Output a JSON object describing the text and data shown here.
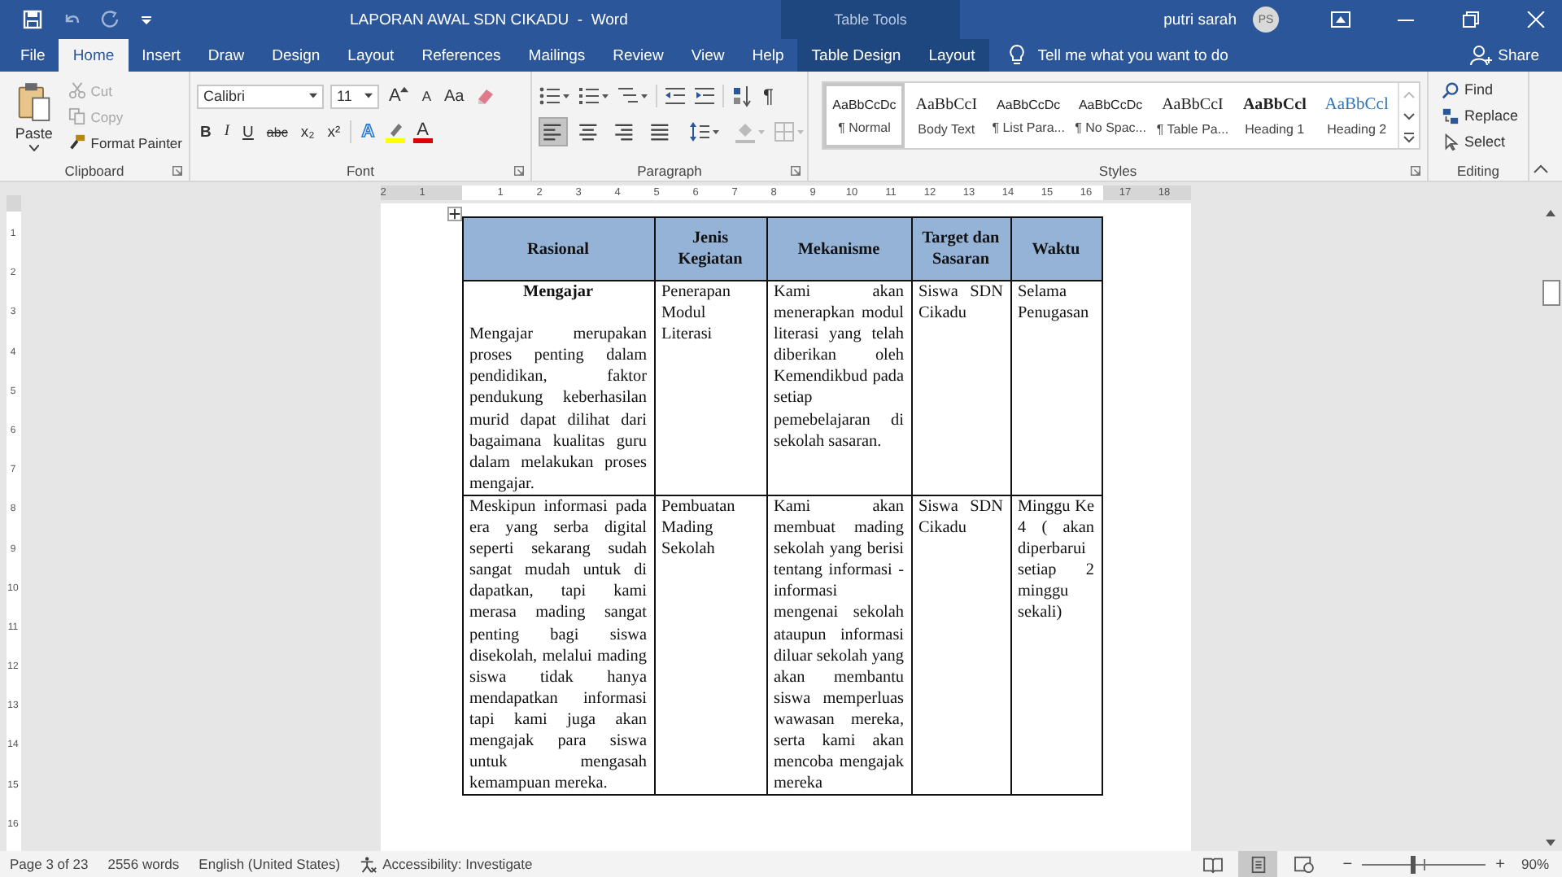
{
  "title_bar": {
    "title": "LAPORAN AWAL SDN CIKADU  -  Word",
    "context_title": "Table Tools",
    "user_name": "putri sarah",
    "avatar_initials": "PS"
  },
  "tabs": [
    {
      "label": "File",
      "selected": false,
      "contextual": false
    },
    {
      "label": "Home",
      "selected": true,
      "contextual": false
    },
    {
      "label": "Insert",
      "selected": false,
      "contextual": false
    },
    {
      "label": "Draw",
      "selected": false,
      "contextual": false
    },
    {
      "label": "Design",
      "selected": false,
      "contextual": false
    },
    {
      "label": "Layout",
      "selected": false,
      "contextual": false
    },
    {
      "label": "References",
      "selected": false,
      "contextual": false
    },
    {
      "label": "Mailings",
      "selected": false,
      "contextual": false
    },
    {
      "label": "Review",
      "selected": false,
      "contextual": false
    },
    {
      "label": "View",
      "selected": false,
      "contextual": false
    },
    {
      "label": "Help",
      "selected": false,
      "contextual": false
    },
    {
      "label": "Table Design",
      "selected": false,
      "contextual": true
    },
    {
      "label": "Layout",
      "selected": false,
      "contextual": true
    }
  ],
  "tell_me": {
    "placeholder": "Tell me what you want to do"
  },
  "share_label": "Share",
  "clipboard": {
    "label": "Clipboard",
    "paste": "Paste",
    "items": [
      {
        "label": "Cut",
        "disabled": true
      },
      {
        "label": "Copy",
        "disabled": true
      },
      {
        "label": "Format Painter",
        "disabled": false
      }
    ]
  },
  "font": {
    "label": "Font",
    "family": "Calibri",
    "size": "11",
    "grow": "A",
    "shrink": "A",
    "change_case": "Aa",
    "format_buttons": [
      "B",
      "I",
      "U",
      "abc",
      "x₂",
      "x²"
    ],
    "effects": "A",
    "font_color": "A"
  },
  "paragraph": {
    "label": "Paragraph",
    "pilcrow": "¶",
    "alignments": [
      {
        "kind": "left",
        "selected": true
      },
      {
        "kind": "center",
        "selected": false
      },
      {
        "kind": "right",
        "selected": false
      },
      {
        "kind": "justify",
        "selected": false
      }
    ]
  },
  "styles": {
    "label": "Styles",
    "items": [
      {
        "preview": "AaBbCcDc",
        "name": "¶ Normal",
        "selected": true
      },
      {
        "preview": "AaBbCcI",
        "name": "Body Text",
        "selected": false
      },
      {
        "preview": "AaBbCcDc",
        "name": "¶ List Para...",
        "selected": false
      },
      {
        "preview": "AaBbCcDc",
        "name": "¶ No Spac...",
        "selected": false
      },
      {
        "preview": "AaBbCcI",
        "name": "¶ Table Pa...",
        "selected": false
      },
      {
        "preview": "AaBbCcl",
        "name": "Heading 1",
        "selected": false
      },
      {
        "preview": "AaBbCcl",
        "name": "Heading 2",
        "selected": false
      }
    ]
  },
  "editing": {
    "label": "Editing",
    "items": [
      "Find",
      "Replace",
      "Select"
    ]
  },
  "ruler": {
    "left_numbers": [
      "2",
      "1"
    ],
    "numbers": [
      "1",
      "2",
      "3",
      "4",
      "5",
      "6",
      "7",
      "8",
      "9",
      "10",
      "11",
      "12",
      "13",
      "14",
      "15",
      "16",
      "17",
      "18"
    ]
  },
  "vertical_ruler": {
    "numbers": [
      "1",
      "2",
      "3",
      "4",
      "5",
      "6",
      "7",
      "8",
      "9",
      "10",
      "11",
      "12",
      "13",
      "14",
      "15",
      "16"
    ]
  },
  "table": {
    "columns": [
      "Rasional",
      "Jenis Kegiatan",
      "Mekanisme",
      "Target dan Sasaran",
      "Waktu"
    ],
    "rows": [
      {
        "cells": [
          {
            "heading": "Mengajar",
            "text": "Mengajar merupakan proses penting dalam pendidikan, faktor pendukung keberhasilan murid dapat dilihat dari bagaimana kualitas guru dalam melakukan proses mengajar."
          },
          {
            "text": "Penerapan Modul Literasi"
          },
          {
            "text": "Kami akan menerapkan modul literasi yang telah diberikan oleh Kemendikbud pada setiap pemebelajaran di sekolah sasaran."
          },
          {
            "text": "Siswa SDN Cikadu"
          },
          {
            "text": "Selama Penugasan"
          }
        ]
      },
      {
        "cells": [
          {
            "text": "Meskipun informasi pada era yang serba digital seperti sekarang sudah sangat mudah untuk di dapatkan, tapi kami merasa mading sangat penting bagi siswa disekolah, melalui mading siswa tidak hanya mendapatkan informasi tapi kami juga akan mengajak para siswa untuk mengasah kemampuan mereka."
          },
          {
            "text": "Pembuatan Mading Sekolah"
          },
          {
            "text": "Kami akan membuat mading sekolah yang berisi tentang informasi - informasi mengenai sekolah ataupun informasi diluar sekolah yang akan membantu siswa memperluas wawasan mereka, serta kami akan mencoba mengajak mereka"
          },
          {
            "text": "Siswa SDN Cikadu"
          },
          {
            "text": "Minggu Ke 4 ( akan diperbarui setiap 2 minggu sekali)"
          }
        ]
      }
    ]
  },
  "status_bar": {
    "page": "Page 3 of 23",
    "words": "2556 words",
    "language": "English (United States)",
    "accessibility": "Accessibility: Investigate",
    "views": [
      {
        "kind": "read",
        "selected": false
      },
      {
        "kind": "print",
        "selected": true
      },
      {
        "kind": "web",
        "selected": false
      }
    ],
    "zoom": {
      "minus": "−",
      "plus": "+",
      "level": 0.4,
      "label": "90%"
    }
  }
}
